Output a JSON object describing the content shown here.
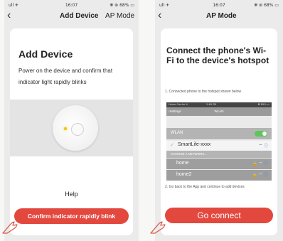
{
  "left_screen": {
    "status": {
      "signal": "ull ✈",
      "time": "16:07",
      "battery": "❋ ⊛ 68% ▭"
    },
    "nav": {
      "title": "Add Device",
      "right_label": "AP Mode"
    },
    "title": "Add Device",
    "description": "Power on the device and confirm that indicator light rapidly blinks",
    "help_label": "Help",
    "confirm_button": "Confirm indicator rapidly blink"
  },
  "right_screen": {
    "status": {
      "signal": "ull ✈",
      "time": "16:07",
      "battery": "❋ ⊛ 68% ▭"
    },
    "nav": {
      "title": "AP Mode"
    },
    "title": "Connect the phone's Wi-Fi to the device's hotspot",
    "step1": "1. Connected phone to the hotspot shown below",
    "wifi_screenshot": {
      "carrier": "Home Carrier ✈",
      "time": "2:48 PM",
      "battery": "✪ 89% ▭",
      "back_label": "Settings",
      "header_title": "WLAN",
      "wlan_label": "WLAN",
      "connected_network": "SmartLife-xxxx",
      "choose_label": "CHOOSE A NETWORK...",
      "networks": [
        "home",
        "home2"
      ]
    },
    "step2": "2. Go back to the App and continue to add devices",
    "connect_button": "Go connect"
  },
  "colors": {
    "accent": "#e3483e",
    "toggle": "#5cc759",
    "info": "#4a8ee8"
  }
}
